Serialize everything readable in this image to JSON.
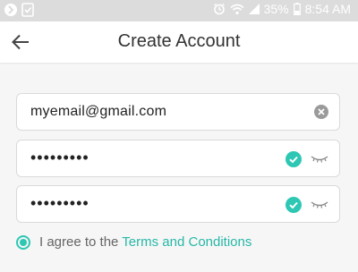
{
  "status_bar": {
    "battery": "35%",
    "time": "8:54 AM"
  },
  "header": {
    "title": "Create Account"
  },
  "form": {
    "email_value": "myemail@gmail.com",
    "password_value": "•••••••••",
    "confirm_password_value": "•••••••••"
  },
  "agreement": {
    "prefix": "I agree to the ",
    "link_label": "Terms and Conditions",
    "checked": true
  },
  "colors": {
    "accent": "#27b8a7",
    "status_bar": "#dcdcdc"
  }
}
